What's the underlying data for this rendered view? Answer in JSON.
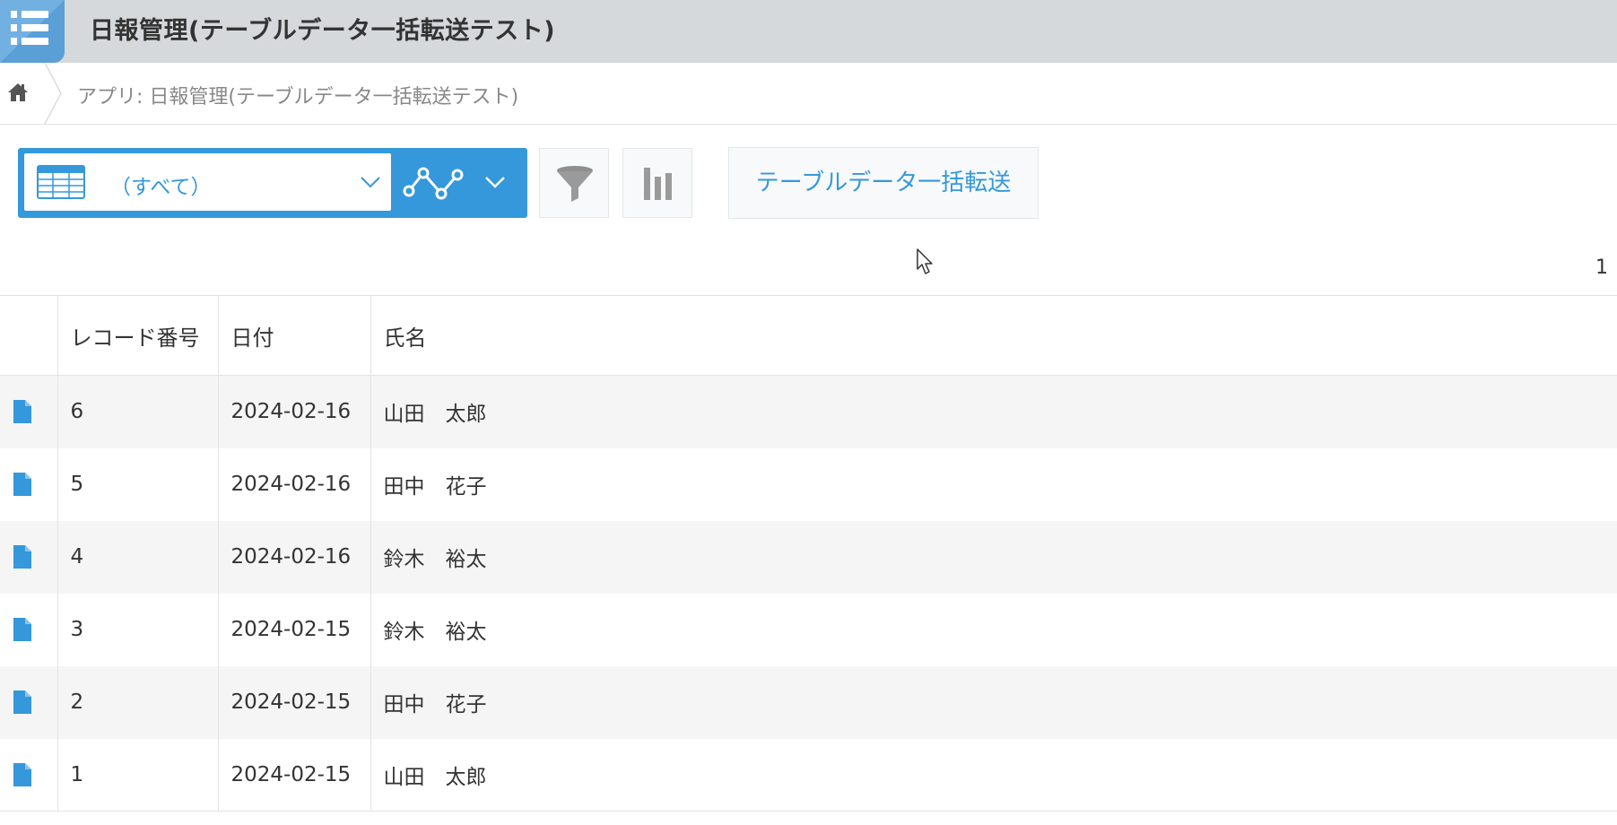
{
  "header": {
    "app_title": "日報管理(テーブルデータ一括転送テスト)",
    "app_icon": "list-app-icon",
    "accent_color": "#3498db"
  },
  "breadcrumb": {
    "home_icon": "home-icon",
    "text": "アプリ: 日報管理(テーブルデータ一括転送テスト)"
  },
  "toolbar": {
    "view_select_value": "（すべて）",
    "view_icon": "table-view-icon",
    "graph_icon": "graph-icon",
    "filter_icon": "filter-icon",
    "chart_icon": "bar-chart-icon",
    "custom_button_label": "テーブルデータ一括転送"
  },
  "pagination": {
    "page_indicator": "1"
  },
  "table": {
    "columns": [
      "レコード番号",
      "日付",
      "氏名"
    ],
    "rows": [
      {
        "record_no": "6",
        "date": "2024-02-16",
        "name": "山田　太郎"
      },
      {
        "record_no": "5",
        "date": "2024-02-16",
        "name": "田中　花子"
      },
      {
        "record_no": "4",
        "date": "2024-02-16",
        "name": "鈴木　裕太"
      },
      {
        "record_no": "3",
        "date": "2024-02-15",
        "name": "鈴木　裕太"
      },
      {
        "record_no": "2",
        "date": "2024-02-15",
        "name": "田中　花子"
      },
      {
        "record_no": "1",
        "date": "2024-02-15",
        "name": "山田　太郎"
      }
    ]
  }
}
